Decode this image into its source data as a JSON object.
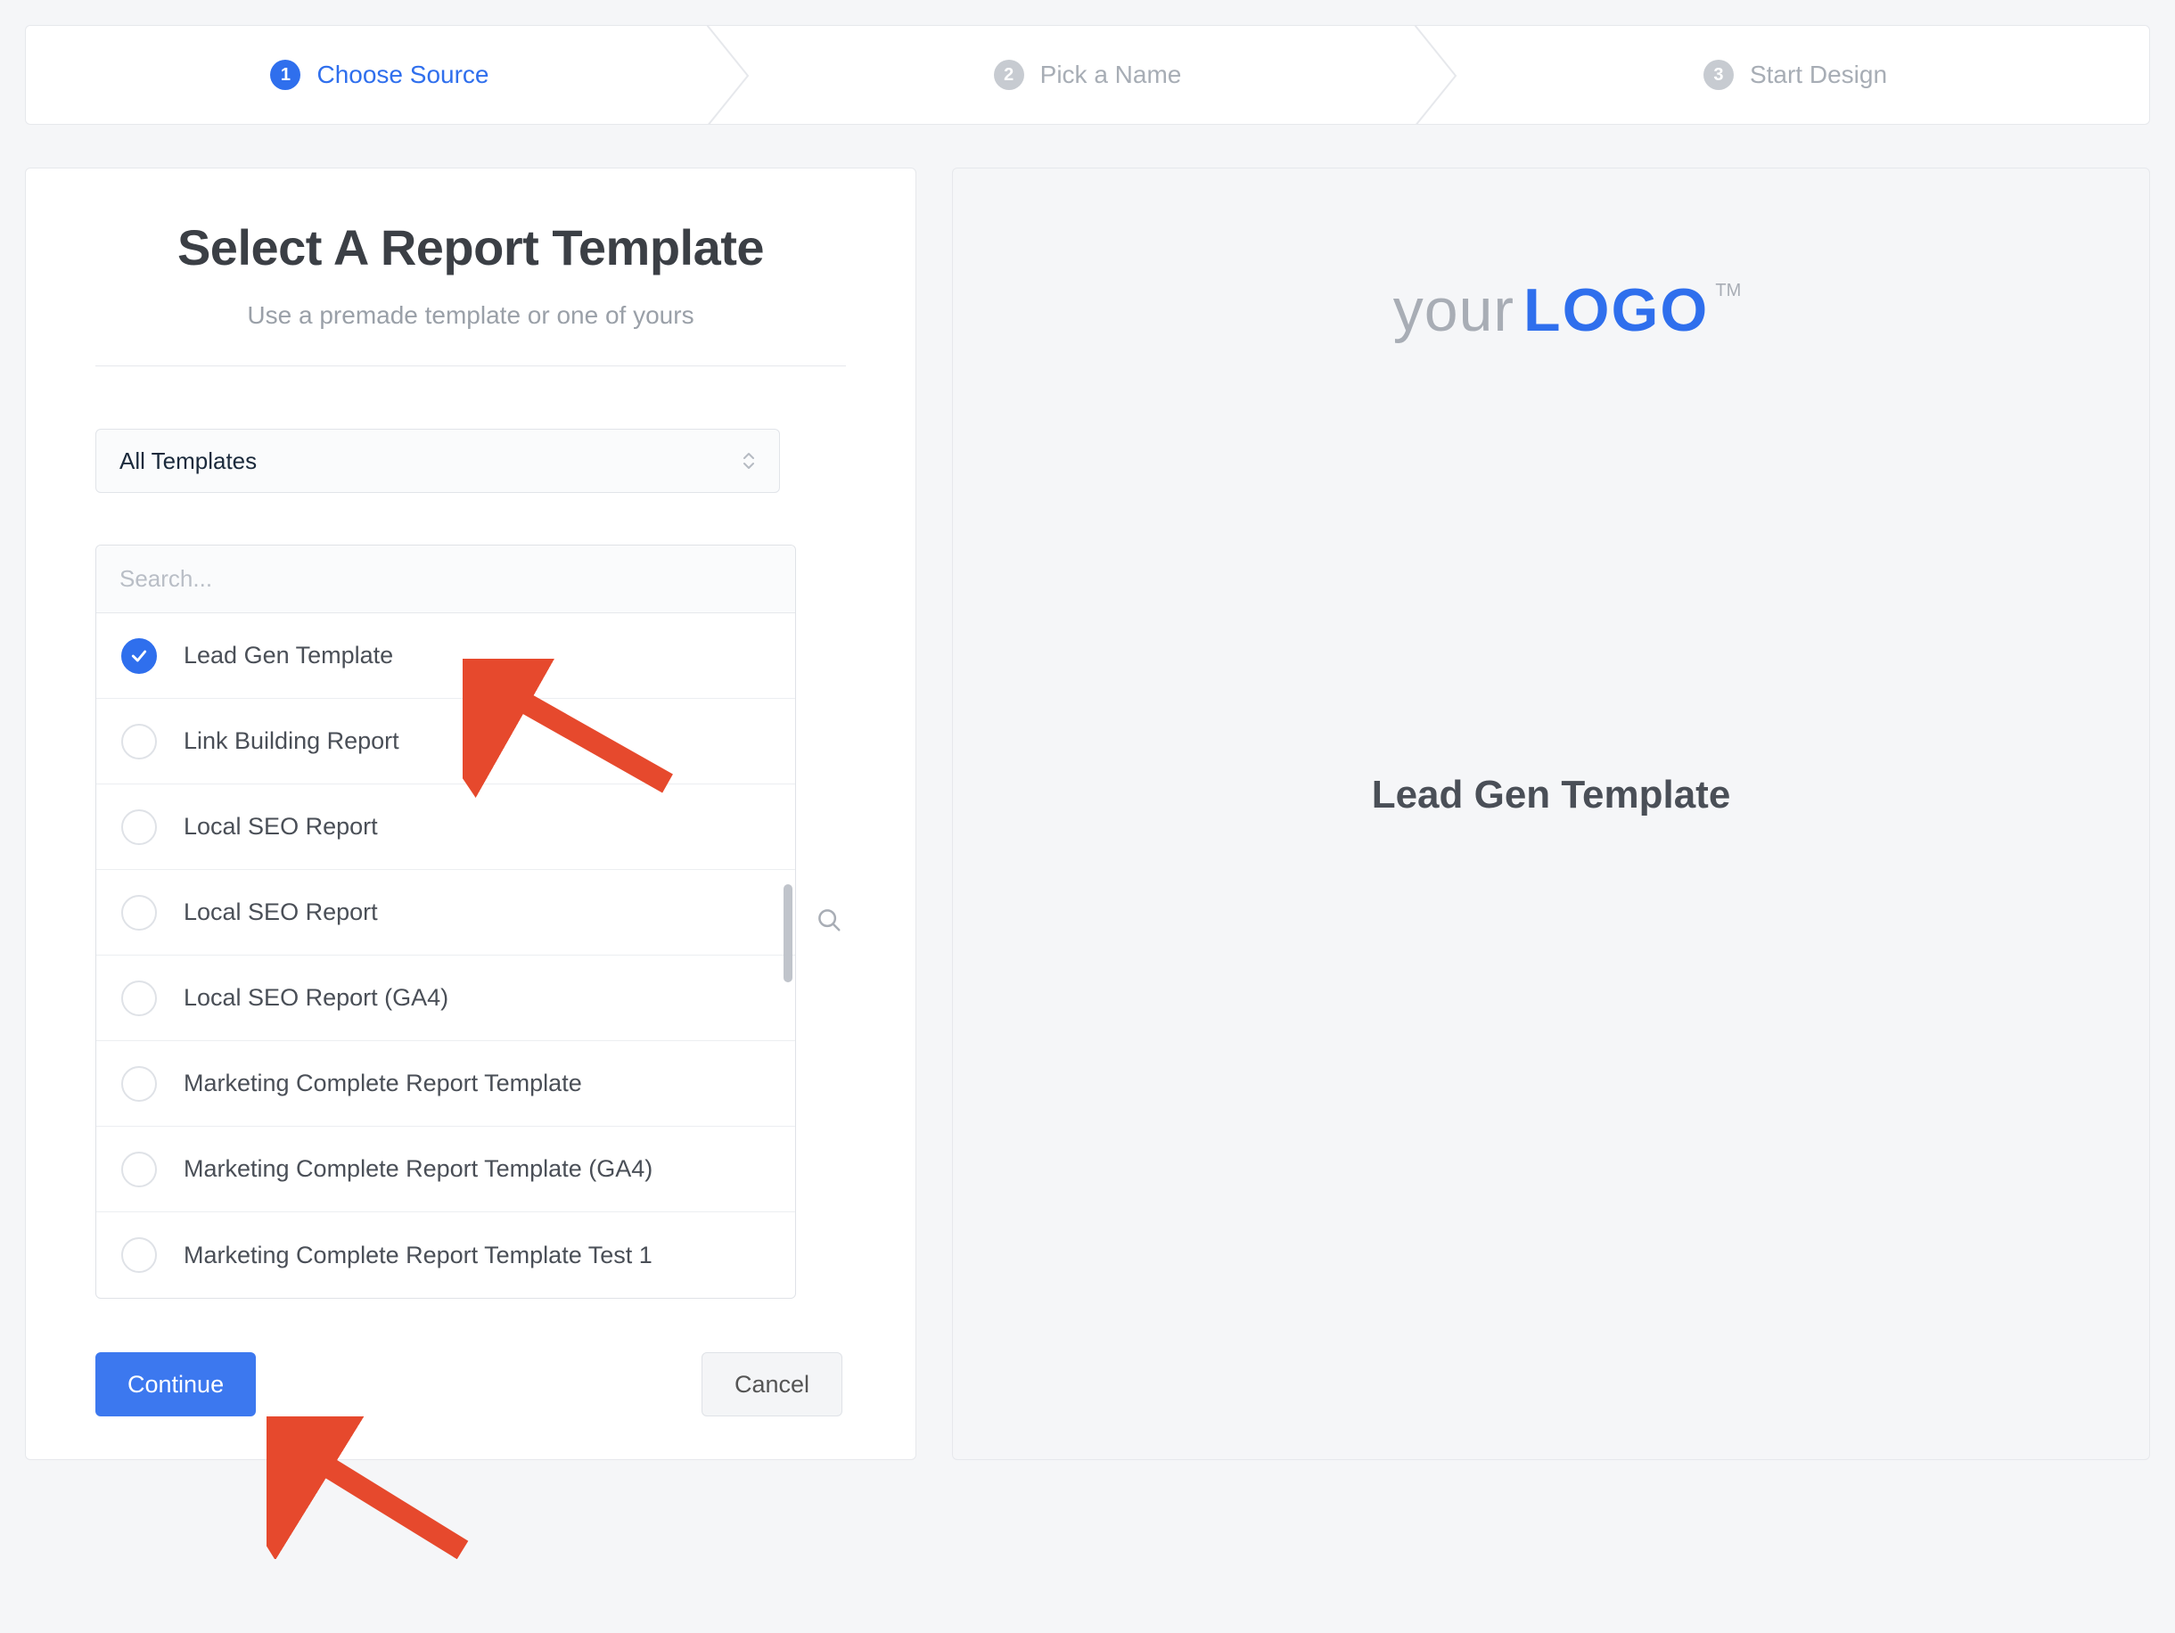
{
  "stepper": {
    "steps": [
      {
        "num": "1",
        "label": "Choose Source",
        "active": true
      },
      {
        "num": "2",
        "label": "Pick a Name",
        "active": false
      },
      {
        "num": "3",
        "label": "Start Design",
        "active": false
      }
    ]
  },
  "left": {
    "title": "Select A Report Template",
    "subtitle": "Use a premade template or one of yours",
    "dropdown_label": "All Templates",
    "search_placeholder": "Search...",
    "templates": [
      {
        "label": "Lead Gen Template",
        "selected": true
      },
      {
        "label": "Link Building Report",
        "selected": false
      },
      {
        "label": "Local SEO Report",
        "selected": false
      },
      {
        "label": "Local SEO Report",
        "selected": false
      },
      {
        "label": "Local SEO Report (GA4)",
        "selected": false
      },
      {
        "label": "Marketing Complete Report Template",
        "selected": false
      },
      {
        "label": "Marketing Complete Report Template (GA4)",
        "selected": false
      },
      {
        "label": "Marketing Complete Report Template Test 1",
        "selected": false
      }
    ],
    "continue_label": "Continue",
    "cancel_label": "Cancel"
  },
  "right": {
    "logo_part1": "your",
    "logo_part2": "LOGO",
    "logo_tm": "TM",
    "preview_title": "Lead Gen Template"
  },
  "colors": {
    "primary": "#2f6fed",
    "annotation": "#e6492d"
  }
}
